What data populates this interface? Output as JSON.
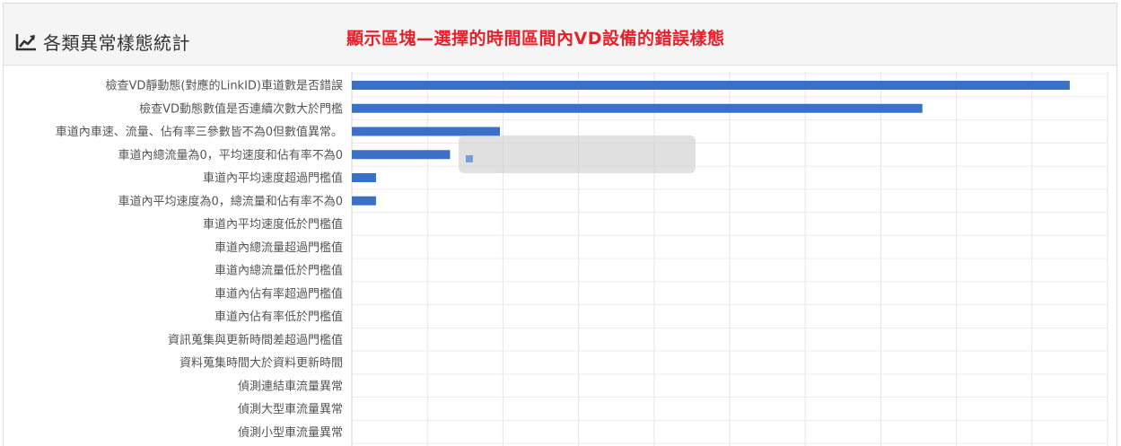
{
  "panel": {
    "title": "各類異常樣態統計",
    "title_icon": "line-chart-icon",
    "annotation": "顯示區塊—選擇的時間區間內VD設備的錯誤樣態",
    "annotation_color": "#e8202a"
  },
  "tooltip": {
    "line1": "",
    "series_label": ""
  },
  "chart_data": {
    "type": "bar",
    "orientation": "horizontal",
    "bar_color": "#3a70c8",
    "grid": true,
    "categories": [
      "檢查VD靜動態(對應的LinkID)車道數是否錯誤",
      "檢查VD動態數值是否連續次數大於門檻",
      "車道內車速、流量、佔有率三參數皆不為0但數值異常。",
      "車道內總流量為0，平均速度和佔有率不為0",
      "車道內平均速度超過門檻值",
      "車道內平均速度為0，總流量和佔有率不為0",
      "車道內平均速度低於門檻值",
      "車道內總流量超過門檻值",
      "車道內總流量低於門檻值",
      "車道內佔有率超過門檻值",
      "車道內佔有率低於門檻值",
      "資訊蒐集與更新時間差超過門檻值",
      "資料蒐集時間大於資料更新時間",
      "偵測連結車流量異常",
      "偵測大型車流量異常",
      "偵測小型車流量異常"
    ],
    "values": [
      4750,
      3775,
      980,
      650,
      160,
      160,
      0,
      0,
      0,
      0,
      0,
      0,
      0,
      0,
      0,
      0
    ],
    "xlim": [
      0,
      5000
    ],
    "x_grid_step": 500
  }
}
